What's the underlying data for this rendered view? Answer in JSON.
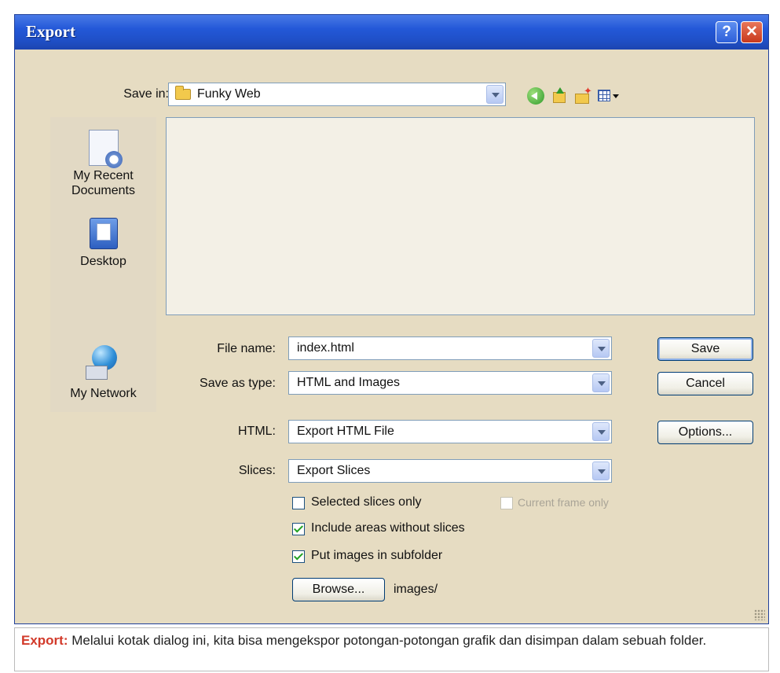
{
  "window": {
    "title": "Export",
    "help_glyph": "?",
    "close_glyph": "✕"
  },
  "save_in": {
    "label": "Save in:",
    "value": "Funky Web"
  },
  "toolbar": [
    "back-icon",
    "up-folder-icon",
    "new-folder-icon",
    "views-menu-icon"
  ],
  "places": [
    {
      "label_line1": "My Recent",
      "label_line2": "Documents",
      "icon": "recent-documents-icon"
    },
    {
      "label": "Desktop",
      "icon": "desktop-icon"
    },
    {
      "label": "My Network",
      "icon": "network-icon"
    }
  ],
  "fields": {
    "file_name": {
      "label": "File name:",
      "value": "index.html"
    },
    "save_as_type": {
      "label": "Save as type:",
      "value": "HTML and Images"
    },
    "html": {
      "label": "HTML:",
      "value": "Export HTML File"
    },
    "slices": {
      "label": "Slices:",
      "value": "Export Slices"
    }
  },
  "buttons": {
    "save": "Save",
    "cancel": "Cancel",
    "options": "Options...",
    "browse": "Browse..."
  },
  "checkboxes": {
    "selected_slices_only": {
      "label": "Selected slices only",
      "checked": false
    },
    "current_frame_only": {
      "label": "Current frame only",
      "checked": false,
      "disabled": true
    },
    "include_areas": {
      "label": "Include areas without slices",
      "checked": true
    },
    "put_images_subfolder": {
      "label": "Put images in subfolder",
      "checked": true
    }
  },
  "subfolder_path": "images/",
  "caption": {
    "title": "Export:",
    "text": " Melalui kotak dialog ini, kita bisa mengekspor potongan-potongan grafik dan disimpan dalam sebuah folder."
  },
  "colors": {
    "titlebar": "#2358d8",
    "dialog_bg": "#e6dcc2",
    "caption_accent": "#d23a2a"
  }
}
